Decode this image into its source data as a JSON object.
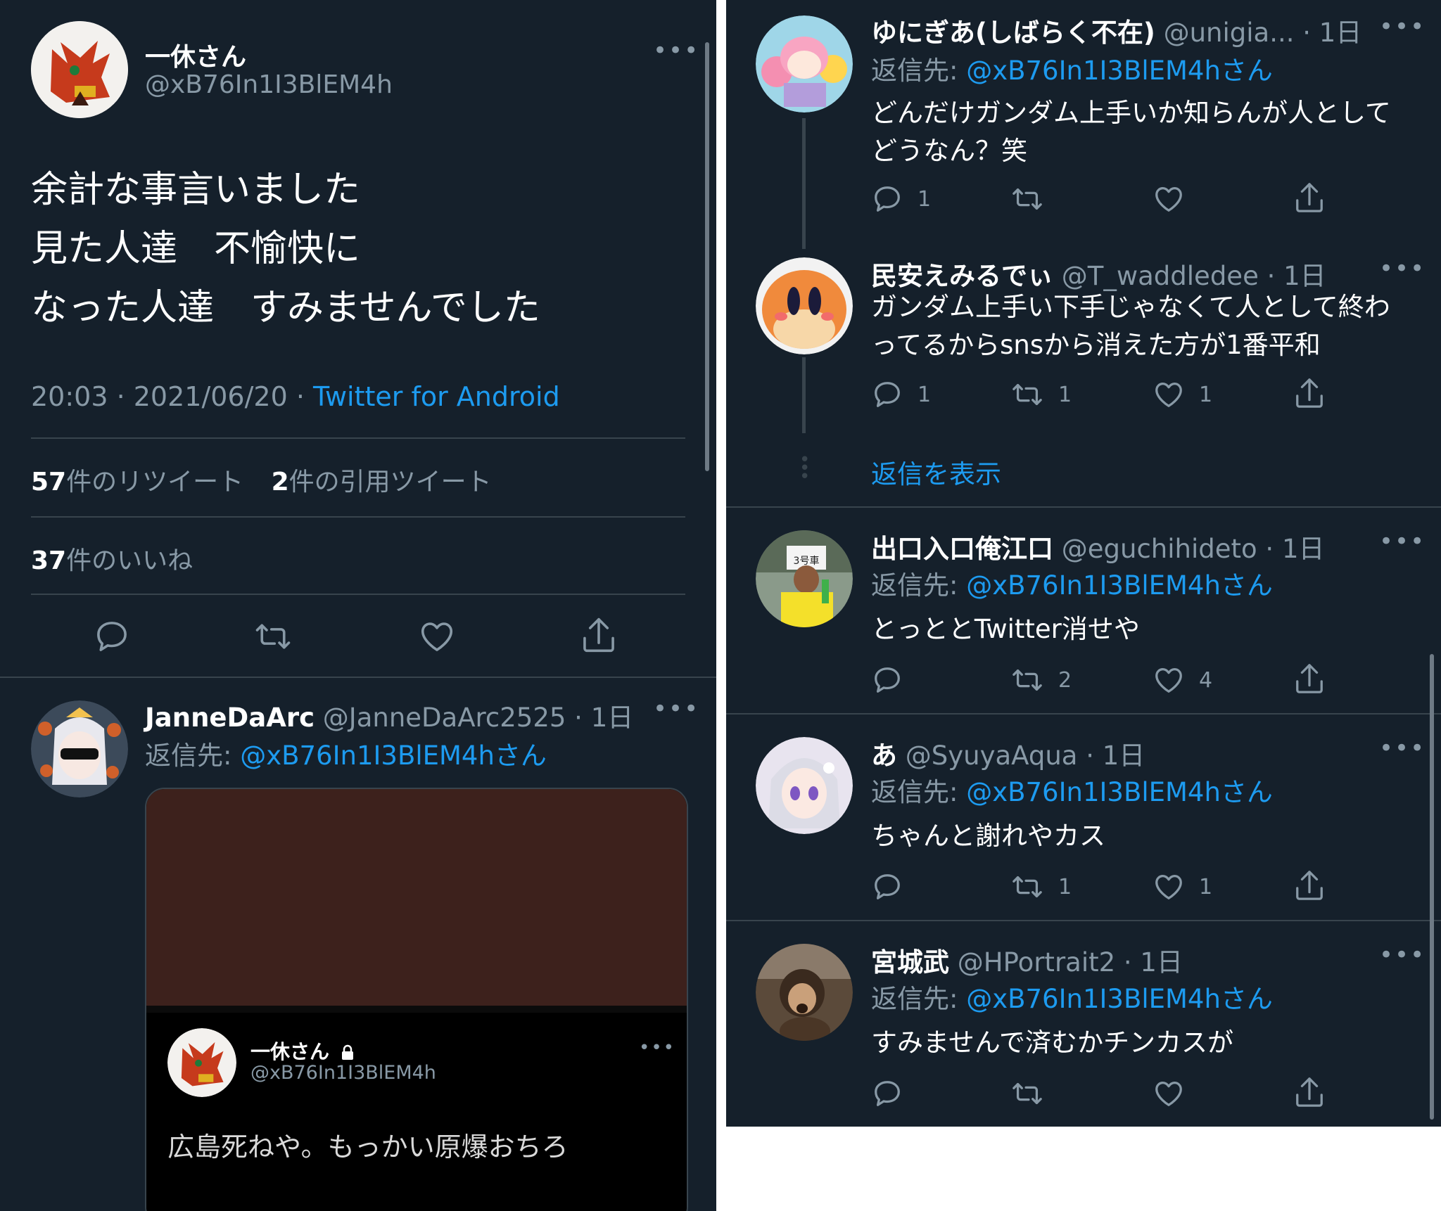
{
  "left": {
    "main_tweet": {
      "name": "一休さん",
      "handle": "@xB76In1I3BlEM4h",
      "text_lines": [
        "余計な事言いました",
        "見た人達　不愉快に",
        "なった人達　すみませんでした"
      ],
      "time_date": "20:03 · 2021/06/20 · ",
      "source": "Twitter for Android",
      "retweets_count": "57",
      "retweets_label": "件のリツイート",
      "quotes_count": "2",
      "quotes_label": "件の引用ツイート",
      "likes_count": "37",
      "likes_label": "件のいいね"
    },
    "reply": {
      "name": "JanneDaArc",
      "handle": "@JanneDaArc2525 · 1日",
      "reply_prefix": "返信先: ",
      "reply_to": "@xB76In1I3BlEM4hさん",
      "quoted": {
        "name": "一休さん",
        "handle": "@xB76In1I3BlEM4h",
        "text": "広島死ねや。もっかい原爆おちろ"
      }
    }
  },
  "right": {
    "tweets": [
      {
        "name": "ゆにぎあ(しばらく不在)",
        "handle": "@unigia... · 1日",
        "reply_prefix": "返信先: ",
        "reply_to": "@xB76In1I3BlEM4hさん",
        "text_lines": [
          "どんだけガンダム上手いか知らんが人として",
          "どうなん？笑"
        ],
        "replies": "1",
        "retweets": "",
        "likes": ""
      },
      {
        "name": "民安えみるでぃ",
        "handle": "@T_waddledee · 1日",
        "reply_prefix": "",
        "reply_to": "",
        "text_lines": [
          "ガンダム上手い下手じゃなくて人として終わ",
          "ってるからsnsから消えた方が1番平和"
        ],
        "replies": "1",
        "retweets": "1",
        "likes": "1"
      },
      {
        "name": "出口入口俺江口",
        "handle": "@eguchihideto · 1日",
        "reply_prefix": "返信先: ",
        "reply_to": "@xB76In1I3BlEM4hさん",
        "text_lines": [
          "とっととTwitter消せや"
        ],
        "replies": "",
        "retweets": "2",
        "likes": "4"
      },
      {
        "name": "あ",
        "handle": "@SyuyaAqua · 1日",
        "reply_prefix": "返信先: ",
        "reply_to": "@xB76In1I3BlEM4hさん",
        "text_lines": [
          "ちゃんと謝れやカス"
        ],
        "replies": "",
        "retweets": "1",
        "likes": "1"
      },
      {
        "name": "宮城武",
        "handle": "@HPortrait2 · 1日",
        "reply_prefix": "返信先: ",
        "reply_to": "@xB76In1I3BlEM4hさん",
        "text_lines": [
          "すみませんで済むかチンカスが"
        ],
        "replies": "",
        "retweets": "",
        "likes": ""
      }
    ],
    "show_replies": "返信を表示",
    "avatar_badge_3": "3号車"
  },
  "colors": {
    "background": "#15202b",
    "link": "#1d9bf0",
    "muted": "#8899a6",
    "divider": "#38444d"
  },
  "icons": [
    "reply-icon",
    "retweet-icon",
    "like-icon",
    "share-icon",
    "more-icon",
    "lock-icon"
  ]
}
